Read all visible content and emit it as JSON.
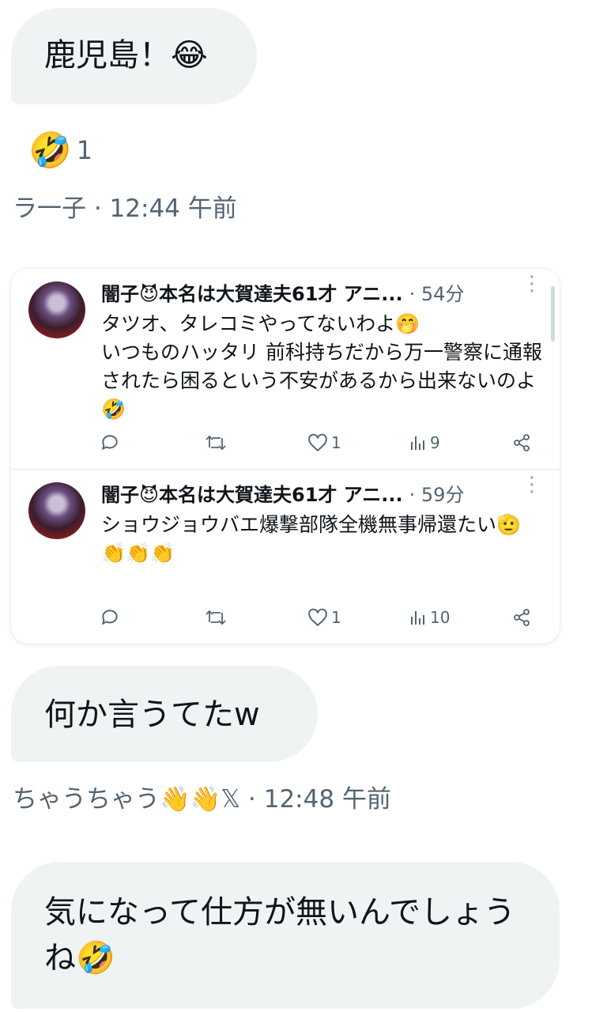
{
  "message1": {
    "text": "鹿児島！😂"
  },
  "reaction": {
    "emoji": "🤣",
    "count": "1"
  },
  "meta1": "ラ一子 · 12:44 午前",
  "quoted_tweets": [
    {
      "name": "闇子😈本名は大賀達夫61才 アニ...",
      "time": "· 54分",
      "text": "タツオ、タレコミやってないわよ🤭\nいつものハッタリ 前科持ちだから万一警察に通報されたら困るという不安があるから出来ないのよ🤣",
      "reply_count": "",
      "retweet_count": "",
      "like_count": "1",
      "view_count": "9"
    },
    {
      "name": "闇子😈本名は大賀達夫61才 アニ...",
      "time": "· 59分",
      "text": "ショウジョウバエ爆撃部隊全機無事帰還たい🫡\n👏👏👏",
      "reply_count": "",
      "retweet_count": "",
      "like_count": "1",
      "view_count": "10"
    }
  ],
  "message2": {
    "text": "何か言うてたw"
  },
  "meta2": "ちゃうちゃう👋👋𝕏 · 12:48 午前",
  "message3": {
    "text": "気になって仕方が無いんでしょうね🤣"
  },
  "colors": {
    "bubble": "#eff3f4",
    "secondary_text": "#536471",
    "text": "#0f1419"
  }
}
